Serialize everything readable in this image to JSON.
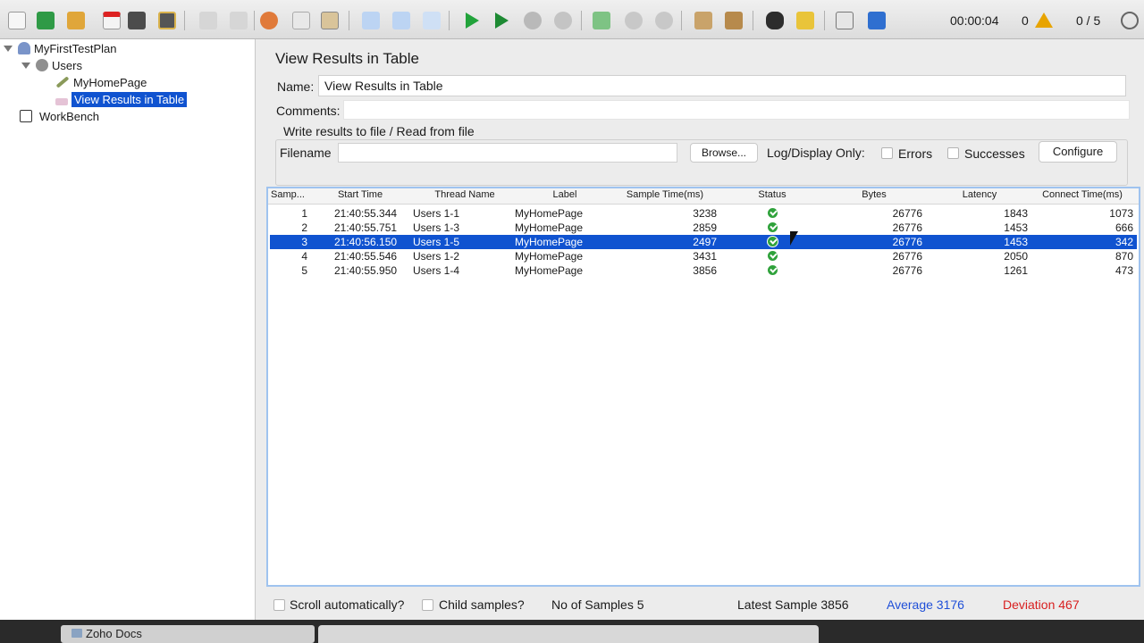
{
  "toolbar": {
    "icons": [
      "new-icon",
      "templates-icon",
      "open-icon",
      "close-icon",
      "save-icon",
      "save-as-icon",
      "undo-icon",
      "redo-icon",
      "cut-icon",
      "copy-icon",
      "paste-icon",
      "expand-icon",
      "collapse-icon",
      "toggle-icon",
      "start-icon",
      "start-no-pause-icon",
      "stop-icon",
      "shutdown-icon",
      "remote-start-icon",
      "remote-stop-icon",
      "remote-shutdown-icon",
      "clear-icon",
      "clear-all-icon",
      "search-icon",
      "reset-search-icon",
      "function-helper-icon",
      "help-icon"
    ],
    "timer": "00:00:04",
    "error_count": "0",
    "threads": "0 / 5"
  },
  "tree": {
    "test_plan": "MyFirstTestPlan",
    "thread_group": "Users",
    "sampler": "MyHomePage",
    "listener": "View Results in Table",
    "workbench": "WorkBench"
  },
  "panel": {
    "title": "View Results in Table",
    "name_label": "Name:",
    "name_value": "View Results in Table",
    "comments_label": "Comments:",
    "file_legend": "Write results to file / Read from file",
    "filename_label": "Filename",
    "filename_value": "",
    "browse_label": "Browse...",
    "log_display_label": "Log/Display Only:",
    "errors_label": "Errors",
    "successes_label": "Successes",
    "configure_label": "Configure"
  },
  "table": {
    "columns": [
      "Samp...",
      "Start Time",
      "Thread Name",
      "Label",
      "Sample Time(ms)",
      "Status",
      "Bytes",
      "Latency",
      "Connect Time(ms)"
    ],
    "rows": [
      {
        "n": "1",
        "start": "21:40:55.344",
        "thread": "Users 1-1",
        "label": "MyHomePage",
        "sample": "3238",
        "bytes": "26776",
        "latency": "1843",
        "connect": "1073"
      },
      {
        "n": "2",
        "start": "21:40:55.751",
        "thread": "Users 1-3",
        "label": "MyHomePage",
        "sample": "2859",
        "bytes": "26776",
        "latency": "1453",
        "connect": "666"
      },
      {
        "n": "3",
        "start": "21:40:56.150",
        "thread": "Users 1-5",
        "label": "MyHomePage",
        "sample": "2497",
        "bytes": "26776",
        "latency": "1453",
        "connect": "342"
      },
      {
        "n": "4",
        "start": "21:40:55.546",
        "thread": "Users 1-2",
        "label": "MyHomePage",
        "sample": "3431",
        "bytes": "26776",
        "latency": "2050",
        "connect": "870"
      },
      {
        "n": "5",
        "start": "21:40:55.950",
        "thread": "Users 1-4",
        "label": "MyHomePage",
        "sample": "3856",
        "bytes": "26776",
        "latency": "1261",
        "connect": "473"
      }
    ],
    "selected_index": 2
  },
  "footer": {
    "scroll_label": "Scroll automatically?",
    "child_label": "Child samples?",
    "samples": "No of Samples 5",
    "latest": "Latest Sample 3856",
    "average": "Average 3176",
    "deviation": "Deviation 467"
  },
  "dock": {
    "zoho": "Zoho Docs"
  },
  "colors": {
    "selection": "#1053d0",
    "average": "#1f4fd8",
    "deviation": "#d81f1f",
    "status_ok": "#2fa23b"
  }
}
